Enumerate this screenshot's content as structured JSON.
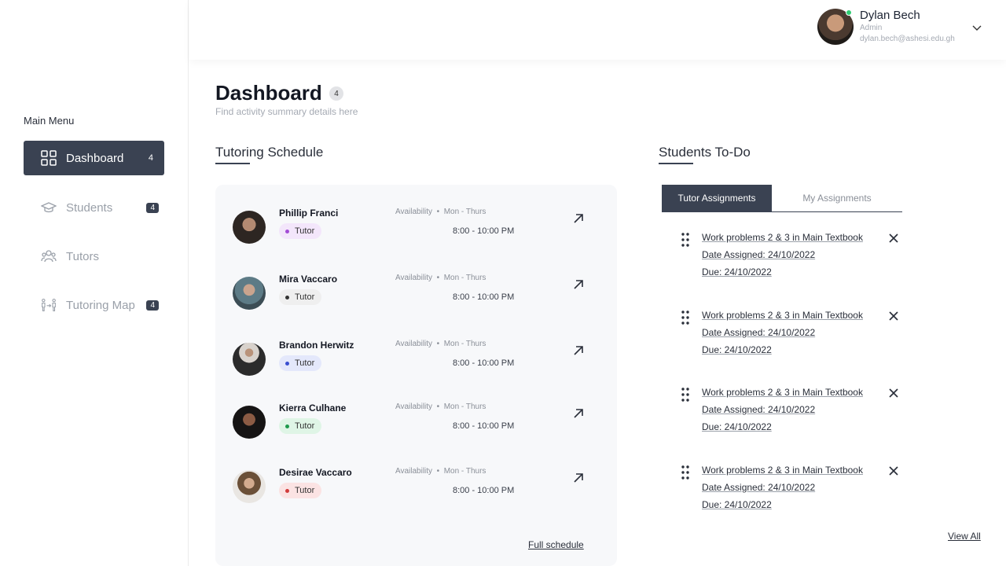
{
  "sidebar": {
    "heading": "Main Menu",
    "items": [
      {
        "label": "Dashboard",
        "badge": "4",
        "icon": "grid-icon",
        "active": true
      },
      {
        "label": "Students",
        "badge": "4",
        "icon": "graduation-cap-icon",
        "active": false
      },
      {
        "label": "Tutors",
        "badge": "",
        "icon": "users-icon",
        "active": false
      },
      {
        "label": "Tutoring Map",
        "badge": "4",
        "icon": "user-connection-icon",
        "active": false
      }
    ]
  },
  "user": {
    "name": "Dylan Bech",
    "role": "Admin",
    "email": "dylan.bech@ashesi.edu.gh",
    "status_color": "#2ecc71"
  },
  "page": {
    "title": "Dashboard",
    "badge": "4",
    "subtitle": "Find activity summary details here"
  },
  "schedule": {
    "title": "Tutoring Schedule",
    "availability_label": "Availability",
    "full_schedule_label": "Full schedule",
    "rows": [
      {
        "name": "Phillip Franci",
        "role": "Tutor",
        "pill_bg": "#f3e6fb",
        "dot": "#a34bd6",
        "days": "Mon - Thurs",
        "hours": "8:00 - 10:00 PM"
      },
      {
        "name": "Mira Vaccaro",
        "role": "Tutor",
        "pill_bg": "#efefef",
        "dot": "#333333",
        "days": "Mon - Thurs",
        "hours": "8:00 - 10:00 PM"
      },
      {
        "name": "Brandon Herwitz",
        "role": "Tutor",
        "pill_bg": "#e4e8fb",
        "dot": "#3a4fd0",
        "days": "Mon - Thurs",
        "hours": "8:00 - 10:00 PM"
      },
      {
        "name": "Kierra Culhane",
        "role": "Tutor",
        "pill_bg": "#dff5e6",
        "dot": "#1f9a4d",
        "days": "Mon - Thurs",
        "hours": "8:00 - 10:00 PM"
      },
      {
        "name": "Desirae Vaccaro",
        "role": "Tutor",
        "pill_bg": "#fbe3e3",
        "dot": "#d23b3b",
        "days": "Mon - Thurs",
        "hours": "8:00 - 10:00 PM"
      }
    ]
  },
  "todo": {
    "title": "Students To-Do",
    "tabs": [
      "Tutor Assignments",
      "My Assignments"
    ],
    "view_all_label": "View All",
    "items": [
      {
        "task": "Work problems 2 & 3 in Main Textbook",
        "assigned": "Date Assigned:  24/10/2022",
        "due": "Due:  24/10/2022"
      },
      {
        "task": "Work problems 2 & 3 in Main Textbook",
        "assigned": "Date Assigned:  24/10/2022",
        "due": "Due:  24/10/2022"
      },
      {
        "task": "Work problems 2 & 3 in Main Textbook",
        "assigned": "Date Assigned:  24/10/2022",
        "due": "Due:  24/10/2022"
      },
      {
        "task": "Work problems 2 & 3 in Main Textbook",
        "assigned": "Date Assigned:  24/10/2022",
        "due": "Due:  24/10/2022"
      }
    ]
  },
  "colors": {
    "accent": "#3a4252"
  }
}
